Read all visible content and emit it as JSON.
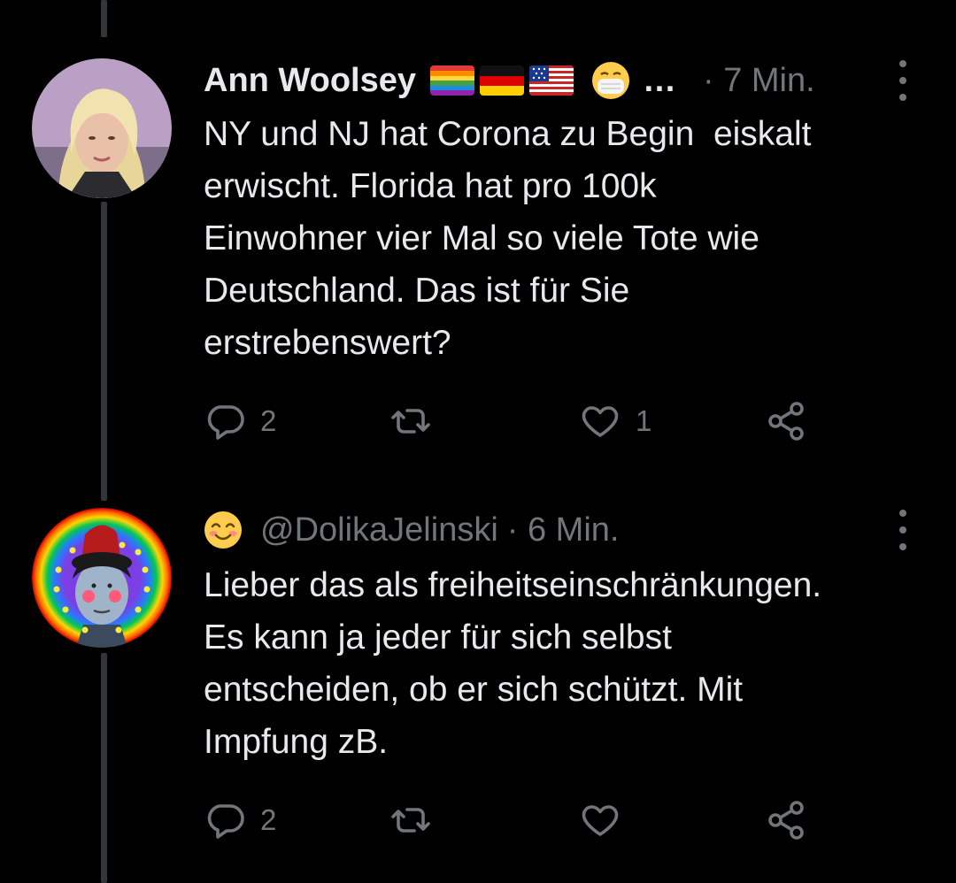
{
  "tweets": [
    {
      "display_name": "Ann Woolsey",
      "flag_emoji": [
        "rainbow-flag",
        "germany-flag",
        "usa-flag"
      ],
      "status_emoji": "mask-face",
      "ellipsis": "…",
      "time": "· 7 Min.",
      "text": "NY und NJ hat Corona zu Begin  eiskalt\nerwischt. Florida hat pro 100k\nEinwohner vier Mal so viele Tote wie\nDeutschland. Das ist für Sie\nerstrebenswert?",
      "reply_count": "2",
      "retweet_count": "",
      "like_count": "1"
    },
    {
      "status_emoji": "smiling-face",
      "handle": "@DolikaJelinski",
      "time": "· 6 Min.",
      "text": "Lieber das als freiheitseinschränkungen.\nEs kann ja jeder für sich selbst\nentscheiden, ob er sich schützt. Mit\nImpfung zB.",
      "reply_count": "2",
      "retweet_count": "",
      "like_count": ""
    }
  ],
  "colors": {
    "background": "#000000",
    "text": "#e7e9ea",
    "muted": "#71767b",
    "thread_line": "#333639"
  }
}
